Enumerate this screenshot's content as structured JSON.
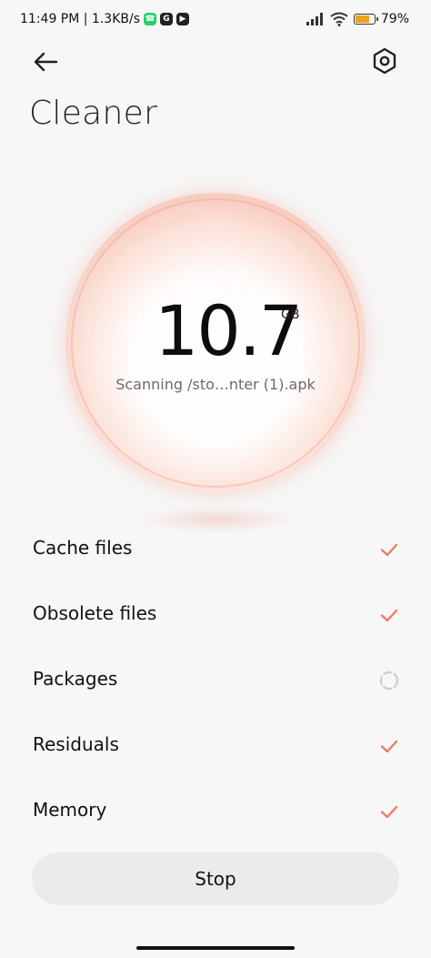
{
  "status_bar": {
    "time_speed": "11:49 PM | 1.3KB/s",
    "battery_percent": "79%",
    "battery_level": 0.79,
    "apps": [
      "whatsapp-icon",
      "g-app-icon",
      "media-app-icon"
    ]
  },
  "header": {
    "title": "Cleaner",
    "back_icon": "arrow-left-icon",
    "settings_icon": "settings-hexagon-icon"
  },
  "scan": {
    "size_value": "10.7",
    "size_unit": "GB",
    "status_text": "Scanning /sto…nter (1).apk"
  },
  "categories": [
    {
      "label": "Cache files",
      "state": "done"
    },
    {
      "label": "Obsolete files",
      "state": "done"
    },
    {
      "label": "Packages",
      "state": "scanning"
    },
    {
      "label": "Residuals",
      "state": "done"
    },
    {
      "label": "Memory",
      "state": "done"
    }
  ],
  "actions": {
    "stop_label": "Stop"
  },
  "colors": {
    "accent": "#ee7b64",
    "orb_tint": "#f4aa96",
    "spinner": "#cfcfcf",
    "button_bg": "#ebebeb"
  }
}
